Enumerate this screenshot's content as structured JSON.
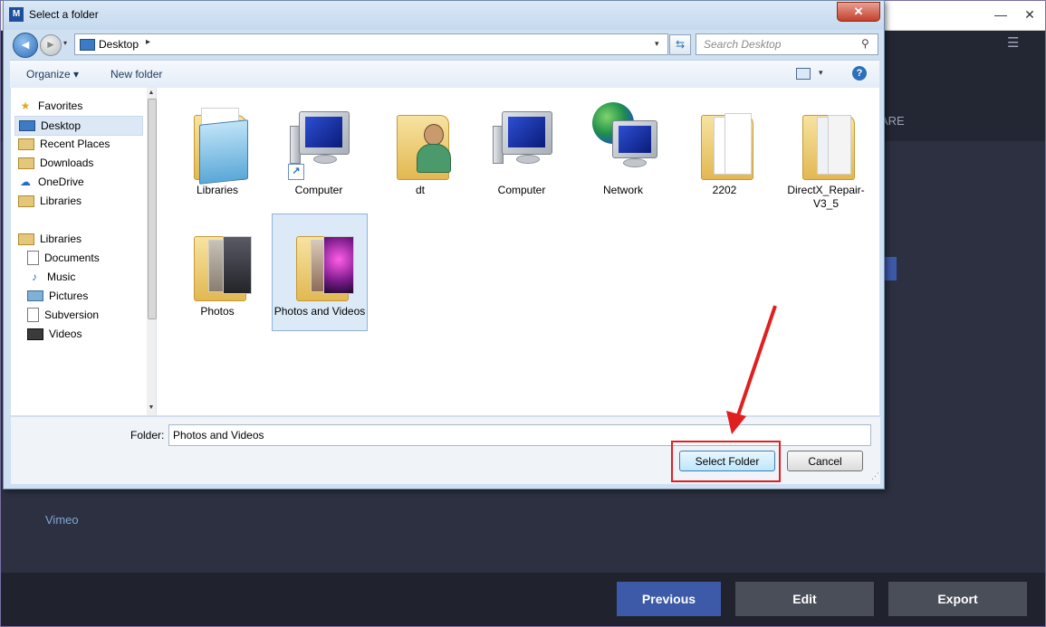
{
  "app": {
    "share_tab": "ARE",
    "sidebar_item": "Vimeo",
    "buttons": {
      "previous": "Previous",
      "edit": "Edit",
      "export": "Export"
    },
    "minimize": "—",
    "close": "✕",
    "menu": "☰"
  },
  "dialog": {
    "app_icon": "M",
    "title": "Select a folder",
    "close": "✕",
    "address": {
      "location": "Desktop",
      "separator": "▸",
      "dropdown": "▾"
    },
    "search_placeholder": "Search Desktop",
    "toolbar": {
      "organize": "Organize ▾",
      "new_folder": "New folder",
      "help": "?"
    },
    "nav_items": [
      {
        "label": "Favorites",
        "icon": "star-icon"
      },
      {
        "label": "Desktop",
        "icon": "desktop-icon"
      },
      {
        "label": "Recent Places",
        "icon": "recent-places-icon"
      },
      {
        "label": "Downloads",
        "icon": "downloads-icon"
      },
      {
        "label": "OneDrive",
        "icon": "onedrive-icon"
      },
      {
        "label": "Libraries",
        "icon": "libraries-icon"
      },
      {
        "label": "Libraries",
        "icon": "libraries-icon"
      },
      {
        "label": "Documents",
        "icon": "documents-icon"
      },
      {
        "label": "Music",
        "icon": "music-icon"
      },
      {
        "label": "Pictures",
        "icon": "pictures-icon"
      },
      {
        "label": "Subversion",
        "icon": "subversion-icon"
      },
      {
        "label": "Videos",
        "icon": "videos-icon"
      }
    ],
    "files": [
      {
        "label": "Libraries",
        "type": "libraries"
      },
      {
        "label": "Computer",
        "type": "computer-shortcut"
      },
      {
        "label": "dt",
        "type": "user-folder"
      },
      {
        "label": "Computer",
        "type": "computer"
      },
      {
        "label": "Network",
        "type": "network"
      },
      {
        "label": "2202",
        "type": "folder"
      },
      {
        "label": "DirectX_Repair-V3_5",
        "type": "folder"
      },
      {
        "label": "Photos",
        "type": "photo-folder"
      },
      {
        "label": "Photos and Videos",
        "type": "photo-folder",
        "selected": true
      }
    ],
    "folder_label": "Folder:",
    "folder_value": "Photos and Videos",
    "select_button": "Select Folder",
    "cancel_button": "Cancel"
  },
  "colors": {
    "annotation": "#e02020",
    "primary_button": "#3d5aa8",
    "secondary_button": "#4a4e59"
  }
}
